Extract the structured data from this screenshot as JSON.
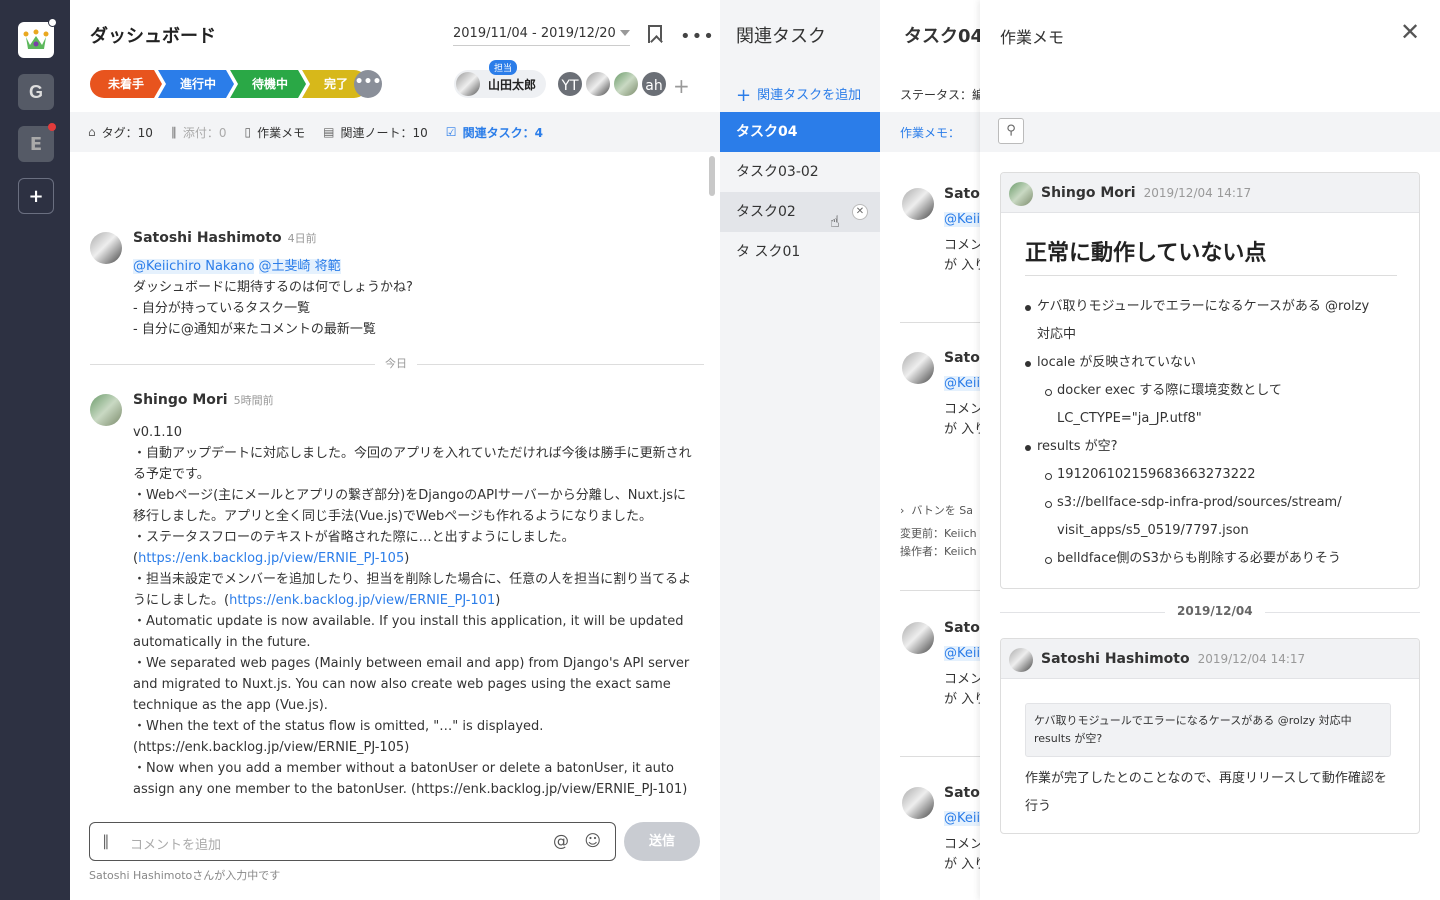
{
  "sidebar": {
    "workspaces": [
      {
        "letter": "",
        "icon": "crown-logo-icon"
      },
      {
        "letter": "G",
        "icon": "google-icon"
      },
      {
        "letter": "E"
      },
      {
        "letter": "+",
        "icon": "plus-icon"
      }
    ]
  },
  "header": {
    "title": "ダッシュボード",
    "date_range": "2019/11/04 - 2019/12/20",
    "status_flow": [
      {
        "label": "未着手",
        "color": "#e8541e"
      },
      {
        "label": "進行中",
        "color": "#2b7de9"
      },
      {
        "label": "待機中",
        "color": "#2aa846"
      },
      {
        "label": "完了",
        "color": "#d7b81a"
      }
    ],
    "status_more": "•••",
    "assignee_badge": "担当",
    "assignee_name": "山田太郎",
    "members": [
      "YT",
      "",
      "",
      "ah"
    ],
    "add_member": "+"
  },
  "tabs": [
    {
      "icon": "🏷",
      "label": "タグ：10"
    },
    {
      "icon": "📎",
      "label": "添付：0"
    },
    {
      "icon": "🗎",
      "label": "作業メモ"
    },
    {
      "icon": "▤",
      "label": "関連ノート：10"
    },
    {
      "icon": "☑",
      "label": "関連タスク：4"
    }
  ],
  "feed": {
    "messages": [
      {
        "author": "Satoshi Hashimoto",
        "when": "4日前",
        "mentions": [
          "@Keiichiro Nakano",
          "@土斐崎 将範"
        ],
        "lines": [
          "ダッシュボードに期待するのは何でしょうかね?",
          "- 自分が持っているタスク一覧",
          "- 自分に@通知が来たコメントの最新一覧"
        ]
      },
      {
        "author": "Shingo Mori",
        "when": "5時間前",
        "version": "v0.1.10",
        "p1": "・自動アップデートに対応しました。今回のアプリを入れていただければ今後は勝手に更新される予定です。",
        "p2": "・Webページ(主にメールとアプリの繋ぎ部分)をDjangoのAPIサーバーから分離し、Nuxt.jsに移行しました。アプリと全く同じ手法(Vue.js)でWebページも作れるようになりました。",
        "p3_pre": "・ステータスフローのテキストが省略された際に…と出すようにしました。(",
        "p3_link": "https://enk.backlog.jp/view/ERNIE_PJ-105",
        "p3_post": ")",
        "p4_pre": "・担当未設定でメンバーを追加したり、担当を削除した場合に、任意の人を担当に割り当てるようにしました。(",
        "p4_link": "https://enk.backlog.jp/view/ERNIE_PJ-101",
        "p4_post": ")",
        "p5": "・Automatic update is now available. If you install this application, it will be updated automatically in the future.",
        "p6": "・We separated web pages (Mainly between email and app) from Django's API server and migrated to Nuxt.js. You can now also create web pages using the exact same technique as the app (Vue.js).",
        "p7": "・When the text of the status flow is omitted, \"…\" is displayed. (https://enk.backlog.jp/view/ERNIE_PJ-105)",
        "p8": "・Now when you add a member without a batonUser or delete a batonUser, it auto assign any one member to the batonUser. (https://enk.backlog.jp/view/ERNIE_PJ-101)"
      }
    ],
    "divider_today": "今日"
  },
  "composer": {
    "placeholder": "コメントを追加",
    "send": "送信",
    "typing": "Satoshi Hashimotoさんが入力中です"
  },
  "related": {
    "title": "関連タスク",
    "add": "関連タスクを追加",
    "items": [
      "タスク04",
      "タスク03-02",
      "タスク02",
      "タ スク01"
    ]
  },
  "bgtask": {
    "title": "タスク04",
    "status": "ステータス：編",
    "memo_tab": "作業メモ：",
    "name": "Satos",
    "mention": "@Keii",
    "line1": "コメン",
    "line2": "が 入り",
    "baton": "バトンを Sa",
    "change_before": "変更前：Keiich",
    "operator": "操作者：Keiich"
  },
  "memo": {
    "title": "作業メモ",
    "note1": {
      "author": "Shingo Mori",
      "date": "2019/12/04 14:17",
      "heading": "正常に動作していない点",
      "items": [
        {
          "level": 1,
          "text": "ケバ取りモジュールでエラーになるケースがある @rolzy"
        },
        {
          "level": 1,
          "cont": true,
          "text": "対応中"
        },
        {
          "level": 1,
          "text": "locale が反映されていない"
        },
        {
          "level": 2,
          "text": "docker exec する際に環境変数として"
        },
        {
          "level": 2,
          "cont": true,
          "text": "LC_CTYPE=\"ja_JP.utf8\""
        },
        {
          "level": 1,
          "text": "results が空?"
        },
        {
          "level": 2,
          "text": "191206102159683663273222"
        },
        {
          "level": 2,
          "text": "s3://bellface-sdp-infra-prod/sources/stream/"
        },
        {
          "level": 2,
          "cont": true,
          "text": "visit_apps/s5_0519/7797.json"
        },
        {
          "level": 2,
          "text": "belldface側のS3からも削除する必要がありそう"
        }
      ]
    },
    "date_sep": "2019/12/04",
    "note2": {
      "author": "Satoshi Hashimoto",
      "date": "2019/12/04 14:17",
      "quote": "ケバ取りモジュールでエラーになるケースがある @rolzy 対応中 results が空?",
      "body": "作業が完了したとのことなので、再度リリースして動作確認を行う"
    }
  }
}
